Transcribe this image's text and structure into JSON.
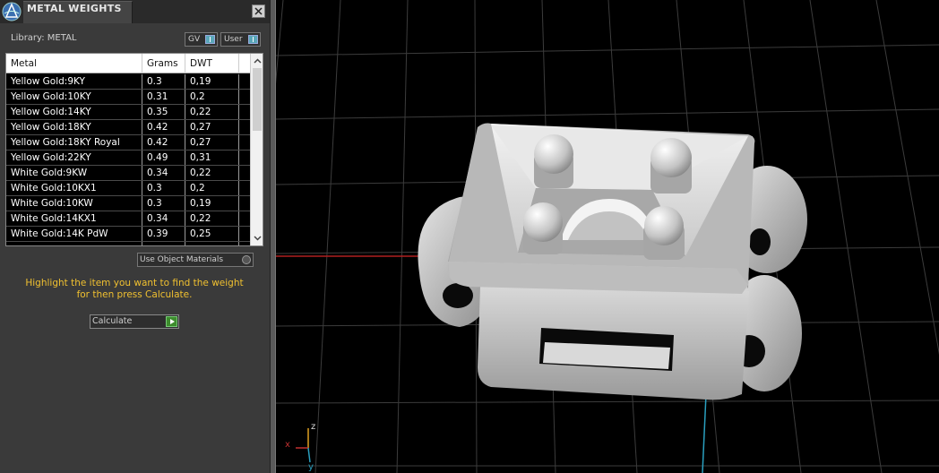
{
  "window": {
    "title": "METAL WEIGHTS",
    "library_label": "Library: METAL",
    "toggle_gv": "GV",
    "toggle_user": "User"
  },
  "table": {
    "headers": [
      "Metal",
      "Grams",
      "DWT"
    ],
    "rows": [
      {
        "metal": "Yellow Gold:9KY",
        "grams": "0.3",
        "dwt": "0,19"
      },
      {
        "metal": "Yellow Gold:10KY",
        "grams": "0.31",
        "dwt": "0,2"
      },
      {
        "metal": "Yellow Gold:14KY",
        "grams": "0.35",
        "dwt": "0,22"
      },
      {
        "metal": "Yellow Gold:18KY",
        "grams": "0.42",
        "dwt": "0,27"
      },
      {
        "metal": "Yellow Gold:18KY Royal",
        "grams": "0.42",
        "dwt": "0,27"
      },
      {
        "metal": "Yellow Gold:22KY",
        "grams": "0.49",
        "dwt": "0,31"
      },
      {
        "metal": "White Gold:9KW",
        "grams": "0.34",
        "dwt": "0,22"
      },
      {
        "metal": "White Gold:10KX1",
        "grams": "0.3",
        "dwt": "0,2"
      },
      {
        "metal": "White Gold:10KW",
        "grams": "0.3",
        "dwt": "0,19"
      },
      {
        "metal": "White Gold:14KX1",
        "grams": "0.34",
        "dwt": "0,22"
      },
      {
        "metal": "White Gold:14K PdW",
        "grams": "0.39",
        "dwt": "0,25"
      }
    ]
  },
  "controls": {
    "use_object_materials": "Use Object Materials",
    "hint_line1": "Highlight the item you want to find the weight",
    "hint_line2": "for then press Calculate.",
    "calculate": "Calculate"
  },
  "viewport": {
    "axis_z": "z",
    "axis_x": "x",
    "axis_y": "y"
  },
  "colors": {
    "panel_bg": "#3a3a3a",
    "hint_text": "#f0c030",
    "grid_line": "#3c3c3c",
    "x_axis": "#b02020",
    "y_axis": "#2aa0c0"
  }
}
